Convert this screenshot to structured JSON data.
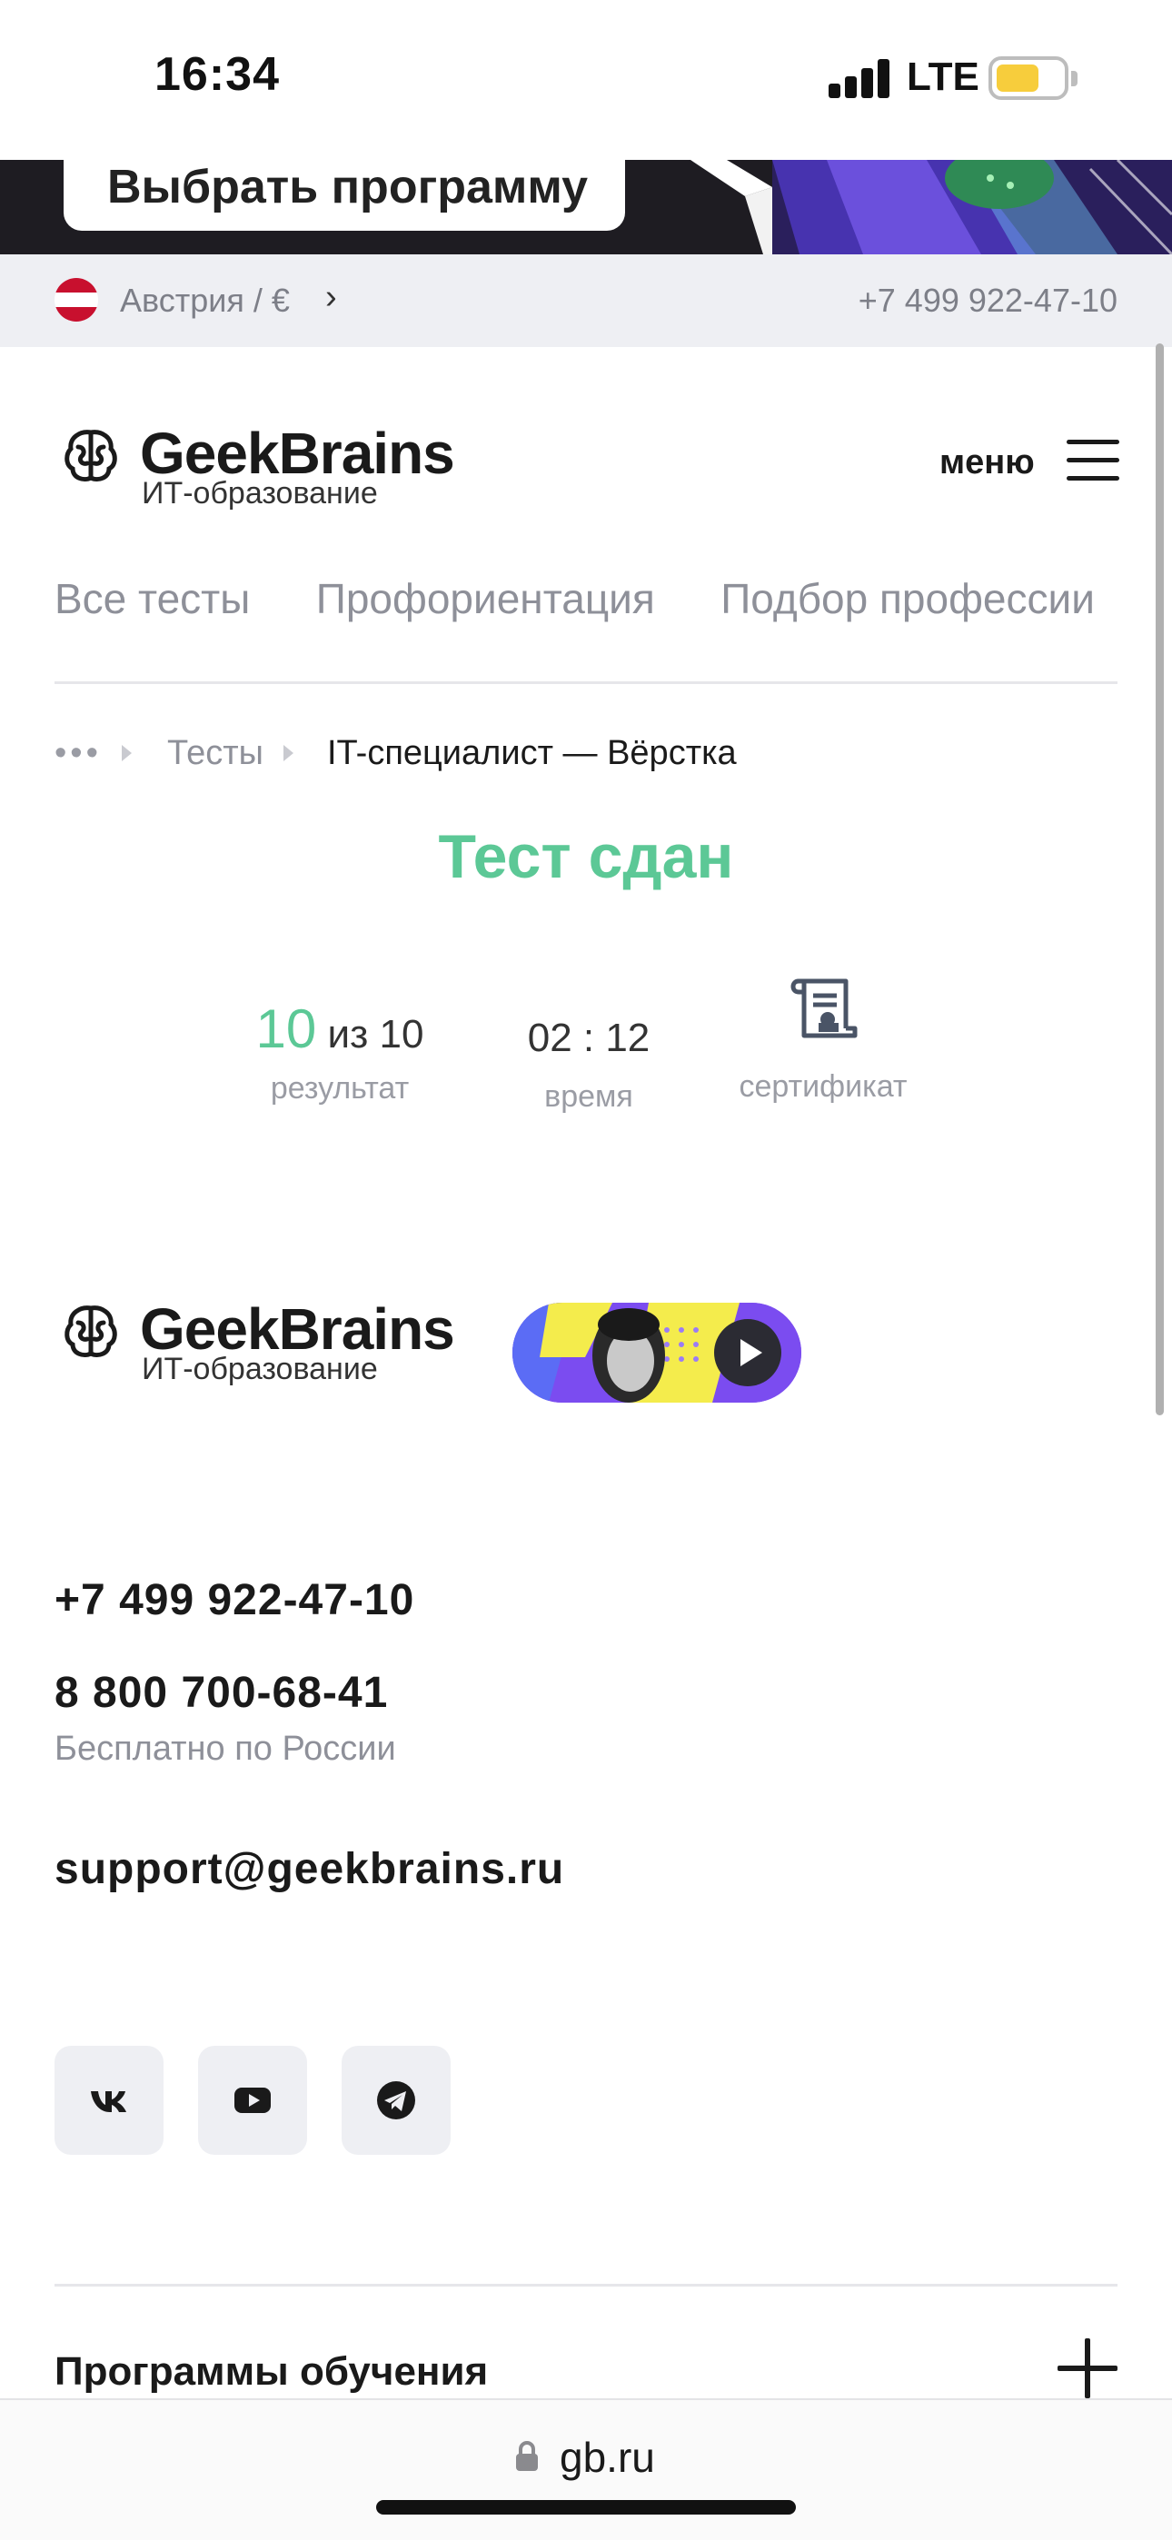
{
  "status_bar": {
    "time": "16:34",
    "network": "LTE",
    "battery_color": "#f7cd3c"
  },
  "banner": {
    "button_label": "Выбрать программу"
  },
  "region_bar": {
    "region": "Австрия / €",
    "phone": "+7 499 922-47-10",
    "flag_colors": [
      "#c8102e",
      "#ffffff",
      "#c8102e"
    ]
  },
  "header": {
    "brand": "GeekBrains",
    "tagline": "ИТ-образование",
    "menu_label": "меню"
  },
  "nav_tabs": [
    {
      "label": "Все тесты"
    },
    {
      "label": "Профориентация"
    },
    {
      "label": "Подбор профессии"
    }
  ],
  "breadcrumb": {
    "ellipsis": "•••",
    "tests": "Тесты",
    "current": "IT-специалист — Вёрстка"
  },
  "result": {
    "title": "Тест сдан",
    "score": "10",
    "score_total": "из 10",
    "score_caption": "результат",
    "time": "02 : 12",
    "time_caption": "время",
    "certificate_caption": "сертификат",
    "accent_color": "#5cc896"
  },
  "footer": {
    "brand": "GeekBrains",
    "tagline": "ИТ-образование",
    "phone_main": "+7 499 922-47-10",
    "phone_free": "8 800 700-68-41",
    "phone_free_note": "Бесплатно по России",
    "email": "support@geekbrains.ru",
    "socials": [
      {
        "icon": "vk-icon"
      },
      {
        "icon": "youtube-icon"
      },
      {
        "icon": "telegram-icon"
      }
    ],
    "programs_label": "Программы обучения"
  },
  "browser": {
    "url": "gb.ru"
  }
}
